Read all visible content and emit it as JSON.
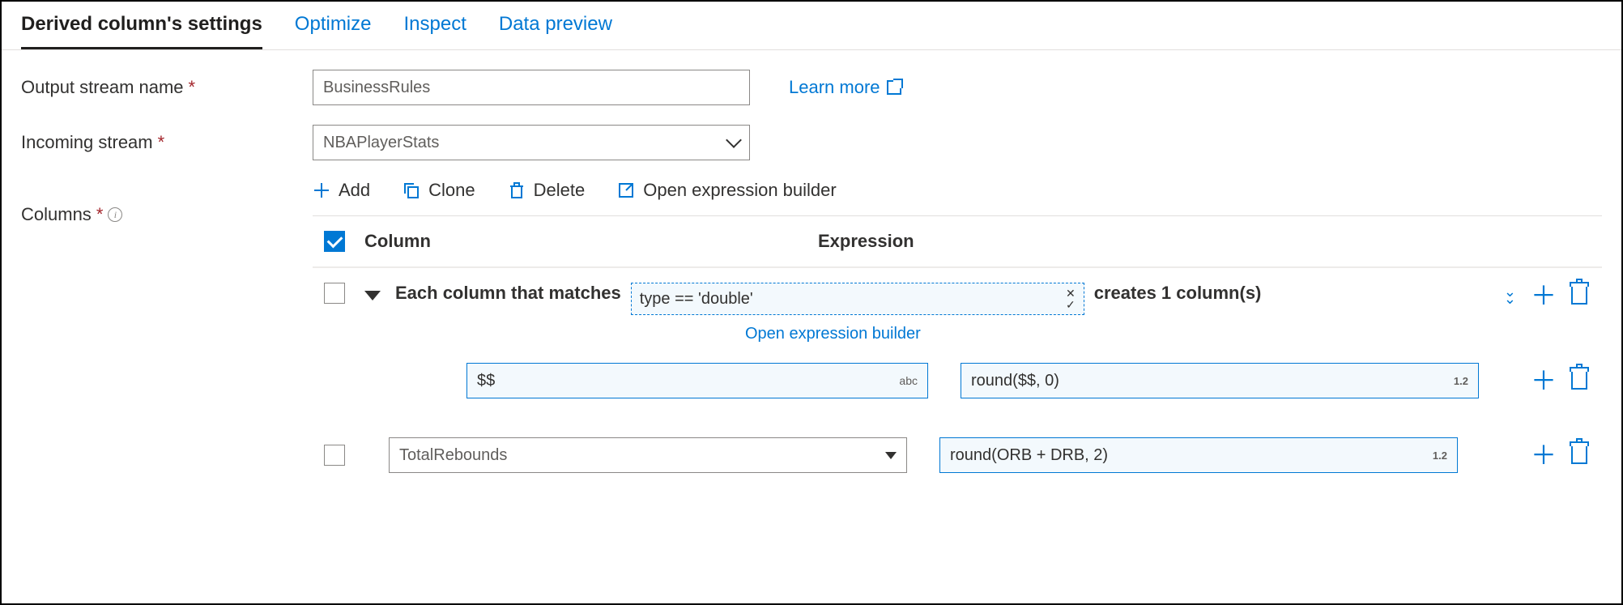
{
  "tabs": {
    "settings": "Derived column's settings",
    "optimize": "Optimize",
    "inspect": "Inspect",
    "preview": "Data preview"
  },
  "form": {
    "output_stream_label": "Output stream name",
    "output_stream_value": "BusinessRules",
    "incoming_stream_label": "Incoming stream",
    "incoming_stream_value": "NBAPlayerStats",
    "learn_more": "Learn more",
    "columns_label": "Columns"
  },
  "toolbar": {
    "add": "Add",
    "clone": "Clone",
    "delete": "Delete",
    "open_builder": "Open expression builder"
  },
  "table": {
    "col_header": "Column",
    "expr_header": "Expression",
    "pattern": {
      "prefix": "Each column that matches",
      "match_expr": "type == 'double'",
      "suffix": "creates 1 column(s)",
      "open_link": "Open expression builder"
    },
    "rows": [
      {
        "column_value": "$$",
        "column_suffix": "abc",
        "expr_value": "round($$, 0)",
        "expr_suffix": "1.2"
      },
      {
        "column_value": "TotalRebounds",
        "expr_value": "round(ORB + DRB, 2)",
        "expr_suffix": "1.2"
      }
    ]
  }
}
